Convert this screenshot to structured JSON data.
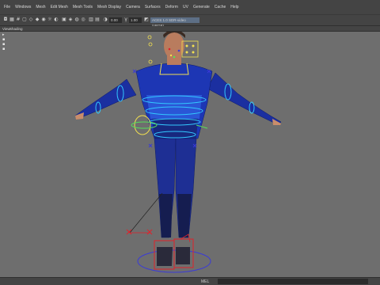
{
  "menu": {
    "items": [
      "File",
      "Windows",
      "Mesh",
      "Edit Mesh",
      "Mesh Tools",
      "Mesh Display",
      "Camera",
      "Surfaces",
      "Deform",
      "UV",
      "Generate",
      "Cache",
      "Help"
    ]
  },
  "toolbar": {
    "time_field": "0.00",
    "scale_field": "1.00",
    "color_space_field": "ACES 1.0 SDR-video (sRGB)"
  },
  "panel": {
    "menus": [
      "View",
      "Shading"
    ]
  },
  "status": {
    "mel_label": "MEL"
  },
  "colors": {
    "ui_dark": "#444444",
    "viewport_bg": "#6e6e6e",
    "rig_cyan": "#33c8ff",
    "rig_yellow": "#f2e050",
    "rig_red": "#e0212b",
    "rig_green": "#55e05a",
    "rig_blue": "#3a3ad8"
  }
}
